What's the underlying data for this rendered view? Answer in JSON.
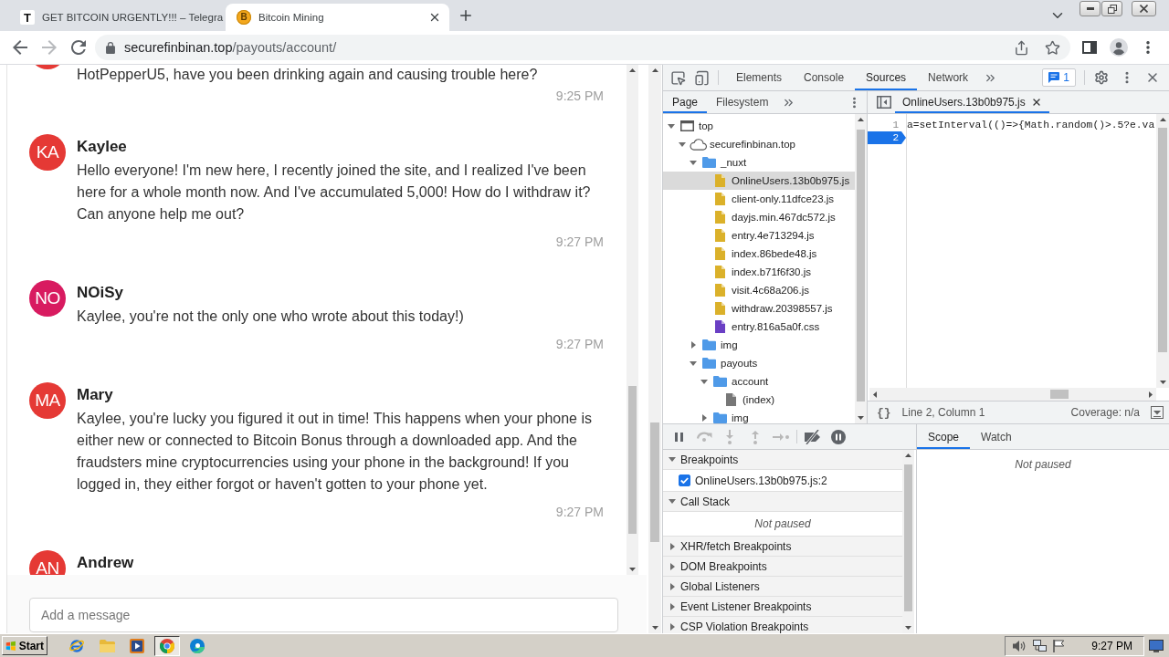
{
  "browser": {
    "tabs": [
      {
        "title": "GET BITCOIN URGENTLY!!! – Telegra",
        "favicon": {
          "kind": "tile",
          "text": "T"
        },
        "selected": false
      },
      {
        "title": "Bitcoin Mining",
        "favicon": {
          "kind": "coin",
          "text": "B"
        },
        "selected": true
      }
    ],
    "nav_buttons": [
      {
        "kind": "back",
        "disabled": false
      },
      {
        "kind": "forward",
        "disabled": true
      },
      {
        "kind": "reload",
        "disabled": false
      }
    ],
    "address": {
      "host": "securefinbinan.top",
      "path": "/payouts/account/"
    }
  },
  "chat": {
    "messages": [
      {
        "cut_off": true,
        "color": "#e53935",
        "text": "HotPepperU5, have you been drinking again and causing trouble here?",
        "time": "9:25 PM"
      },
      {
        "cut_off": false,
        "color": "#e53935",
        "initials": "KA",
        "name": "Kaylee",
        "text": "Hello everyone! I'm new here, I recently joined the site, and I realized I've been here for a whole month now. And I've accumulated 5,000! How do I withdraw it? Can anyone help me out?",
        "time": "9:27 PM"
      },
      {
        "cut_off": false,
        "color": "#d81b60",
        "initials": "NO",
        "name": "NOiSy",
        "text": "Kaylee, you're not the only one who wrote about this today!)",
        "time": "9:27 PM"
      },
      {
        "cut_off": false,
        "color": "#e53935",
        "initials": "MA",
        "name": "Mary",
        "text": "Kaylee, you're lucky you figured it out in time! This happens when your phone is either new or connected to Bitcoin Bonus through a downloaded app. And the fraudsters mine cryptocurrencies using your phone in the background! If you logged in, they either forgot or haven't gotten to your phone yet.",
        "time": "9:27 PM"
      },
      {
        "cut_off": false,
        "color": "#e53935",
        "initials": "AN",
        "name": "Andrew"
      }
    ],
    "input": {
      "placeholder": "Add a message"
    }
  },
  "devtools": {
    "panels": [
      {
        "label": "Elements",
        "selected": false
      },
      {
        "label": "Console",
        "selected": false
      },
      {
        "label": "Sources",
        "selected": true
      },
      {
        "label": "Network",
        "selected": false
      }
    ],
    "issues_count": "1",
    "navigator": {
      "tabs": [
        {
          "label": "Page",
          "selected": true
        },
        {
          "label": "Filesystem",
          "selected": false
        }
      ],
      "tree": [
        {
          "name": "top",
          "kind": "frame",
          "expanded": true,
          "selected": false,
          "children": [
            {
              "name": "securefinbinan.top",
              "kind": "domain",
              "expanded": true,
              "selected": false,
              "children": [
                {
                  "name": "_nuxt",
                  "kind": "folder",
                  "expanded": true,
                  "selected": false,
                  "children": [
                    {
                      "name": "OnlineUsers.13b0b975.js",
                      "kind": "script",
                      "selected": true
                    },
                    {
                      "name": "client-only.11dfce23.js",
                      "kind": "script",
                      "selected": false
                    },
                    {
                      "name": "dayjs.min.467dc572.js",
                      "kind": "script",
                      "selected": false
                    },
                    {
                      "name": "entry.4e713294.js",
                      "kind": "script",
                      "selected": false
                    },
                    {
                      "name": "index.86bede48.js",
                      "kind": "script",
                      "selected": false
                    },
                    {
                      "name": "index.b71f6f30.js",
                      "kind": "script",
                      "selected": false
                    },
                    {
                      "name": "visit.4c68a206.js",
                      "kind": "script",
                      "selected": false
                    },
                    {
                      "name": "withdraw.20398557.js",
                      "kind": "script",
                      "selected": false
                    },
                    {
                      "name": "entry.816a5a0f.css",
                      "kind": "stylesheet",
                      "selected": false
                    }
                  ]
                },
                {
                  "name": "img",
                  "kind": "folder",
                  "expanded": false,
                  "selected": false
                },
                {
                  "name": "payouts",
                  "kind": "folder",
                  "expanded": true,
                  "selected": false,
                  "children": [
                    {
                      "name": "account",
                      "kind": "folder",
                      "expanded": true,
                      "selected": false,
                      "children": [
                        {
                          "name": "(index)",
                          "kind": "document",
                          "selected": false
                        }
                      ]
                    },
                    {
                      "name": "img",
                      "kind": "folder",
                      "expanded": false,
                      "selected": false
                    }
                  ]
                }
              ]
            }
          ]
        }
      ]
    },
    "editor": {
      "tabs": [
        {
          "label": "OnlineUsers.13b0b975.js",
          "selected": true
        }
      ],
      "lines": [
        {
          "number": "1",
          "code": "a=setInterval(()=>{Math.random()>.5?e.va",
          "breakpoint": false
        },
        {
          "number": "2",
          "breakpoint": true
        }
      ],
      "format_button": "{}",
      "cursor": "Line 2, Column 1",
      "coverage": "Coverage: n/a"
    },
    "debugger": {
      "controls": [
        {
          "kind": "pause",
          "disabled": false
        },
        {
          "kind": "step-over",
          "disabled": true
        },
        {
          "kind": "step-into",
          "disabled": true
        },
        {
          "kind": "step-out",
          "disabled": true
        },
        {
          "kind": "step",
          "disabled": true
        },
        {
          "kind": "deactivate",
          "disabled": false
        },
        {
          "kind": "pause-exceptions",
          "disabled": false
        }
      ],
      "sections": [
        {
          "title": "Breakpoints",
          "expanded": true,
          "items": [
            {
              "kind": "breakpoint",
              "label": "OnlineUsers.13b0b975.js:2",
              "checked": true
            }
          ]
        },
        {
          "title": "Call Stack",
          "expanded": true,
          "items": [
            {
              "kind": "message",
              "label": "Not paused"
            }
          ]
        },
        {
          "title": "XHR/fetch Breakpoints",
          "expanded": false
        },
        {
          "title": "DOM Breakpoints",
          "expanded": false
        },
        {
          "title": "Global Listeners",
          "expanded": false
        },
        {
          "title": "Event Listener Breakpoints",
          "expanded": false
        },
        {
          "title": "CSP Violation Breakpoints",
          "expanded": false
        }
      ],
      "side_tabs": [
        {
          "label": "Scope",
          "selected": true
        },
        {
          "label": "Watch",
          "selected": false
        }
      ],
      "side_message": "Not paused"
    }
  },
  "taskbar": {
    "start": "Start",
    "apps": [
      {
        "kind": "ie",
        "active": false
      },
      {
        "kind": "explorer",
        "active": false
      },
      {
        "kind": "media",
        "active": false
      },
      {
        "kind": "chrome",
        "active": true
      },
      {
        "kind": "edge",
        "active": false
      }
    ],
    "clock": "9:27 PM"
  }
}
